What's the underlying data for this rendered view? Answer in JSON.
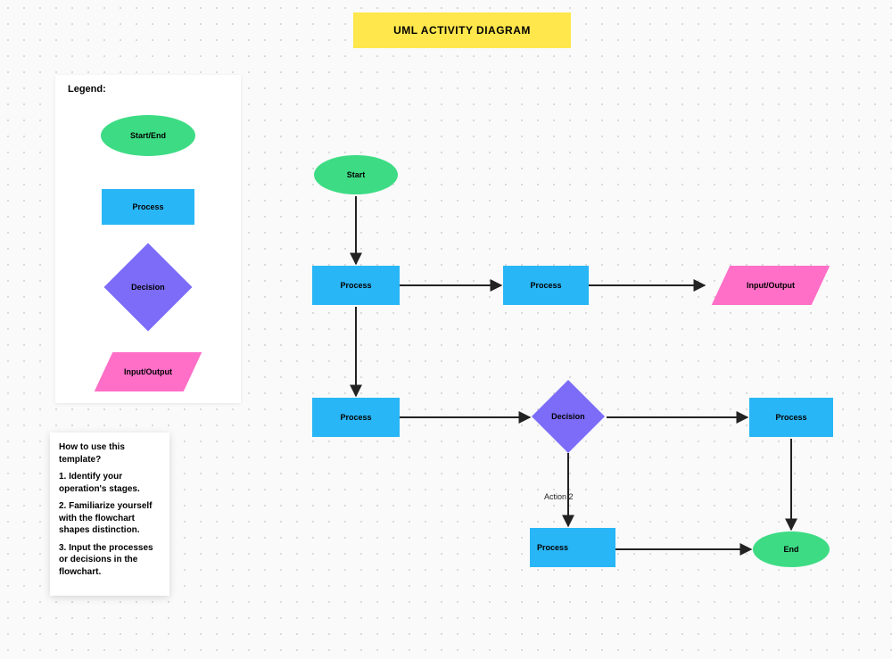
{
  "title": "UML ACTIVITY DIAGRAM",
  "legend": {
    "heading": "Legend:",
    "start_end": "Start/End",
    "process": "Process",
    "decision": "Decision",
    "io": "Input/Output"
  },
  "howto": {
    "heading": "How to use this template?",
    "step1": "1. Identify your operation's stages.",
    "step2": "2. Familiarize yourself with the flowchart shapes distinction.",
    "step3": "3. Input the processes or decisions in the flowchart."
  },
  "nodes": {
    "start": "Start",
    "p1": "Process",
    "p2": "Process",
    "io1": "Input/Output",
    "p3": "Process",
    "decision": "Decision",
    "p4": "Process",
    "p5": "Process",
    "end": "End"
  },
  "edge_labels": {
    "action2": "Action 2"
  },
  "chart_data": {
    "type": "uml-activity",
    "nodes": [
      {
        "id": "start",
        "kind": "terminator",
        "label": "Start"
      },
      {
        "id": "p1",
        "kind": "process",
        "label": "Process"
      },
      {
        "id": "p2",
        "kind": "process",
        "label": "Process"
      },
      {
        "id": "io1",
        "kind": "io",
        "label": "Input/Output"
      },
      {
        "id": "p3",
        "kind": "process",
        "label": "Process"
      },
      {
        "id": "decision",
        "kind": "decision",
        "label": "Decision"
      },
      {
        "id": "p4",
        "kind": "process",
        "label": "Process"
      },
      {
        "id": "p5",
        "kind": "process",
        "label": "Process"
      },
      {
        "id": "end",
        "kind": "terminator",
        "label": "End"
      }
    ],
    "edges": [
      {
        "from": "start",
        "to": "p1"
      },
      {
        "from": "p1",
        "to": "p2"
      },
      {
        "from": "p2",
        "to": "io1"
      },
      {
        "from": "p1",
        "to": "p3"
      },
      {
        "from": "p3",
        "to": "decision"
      },
      {
        "from": "decision",
        "to": "p4"
      },
      {
        "from": "decision",
        "to": "p5",
        "label": "Action 2"
      },
      {
        "from": "p5",
        "to": "end"
      },
      {
        "from": "p4",
        "to": "end"
      }
    ]
  }
}
